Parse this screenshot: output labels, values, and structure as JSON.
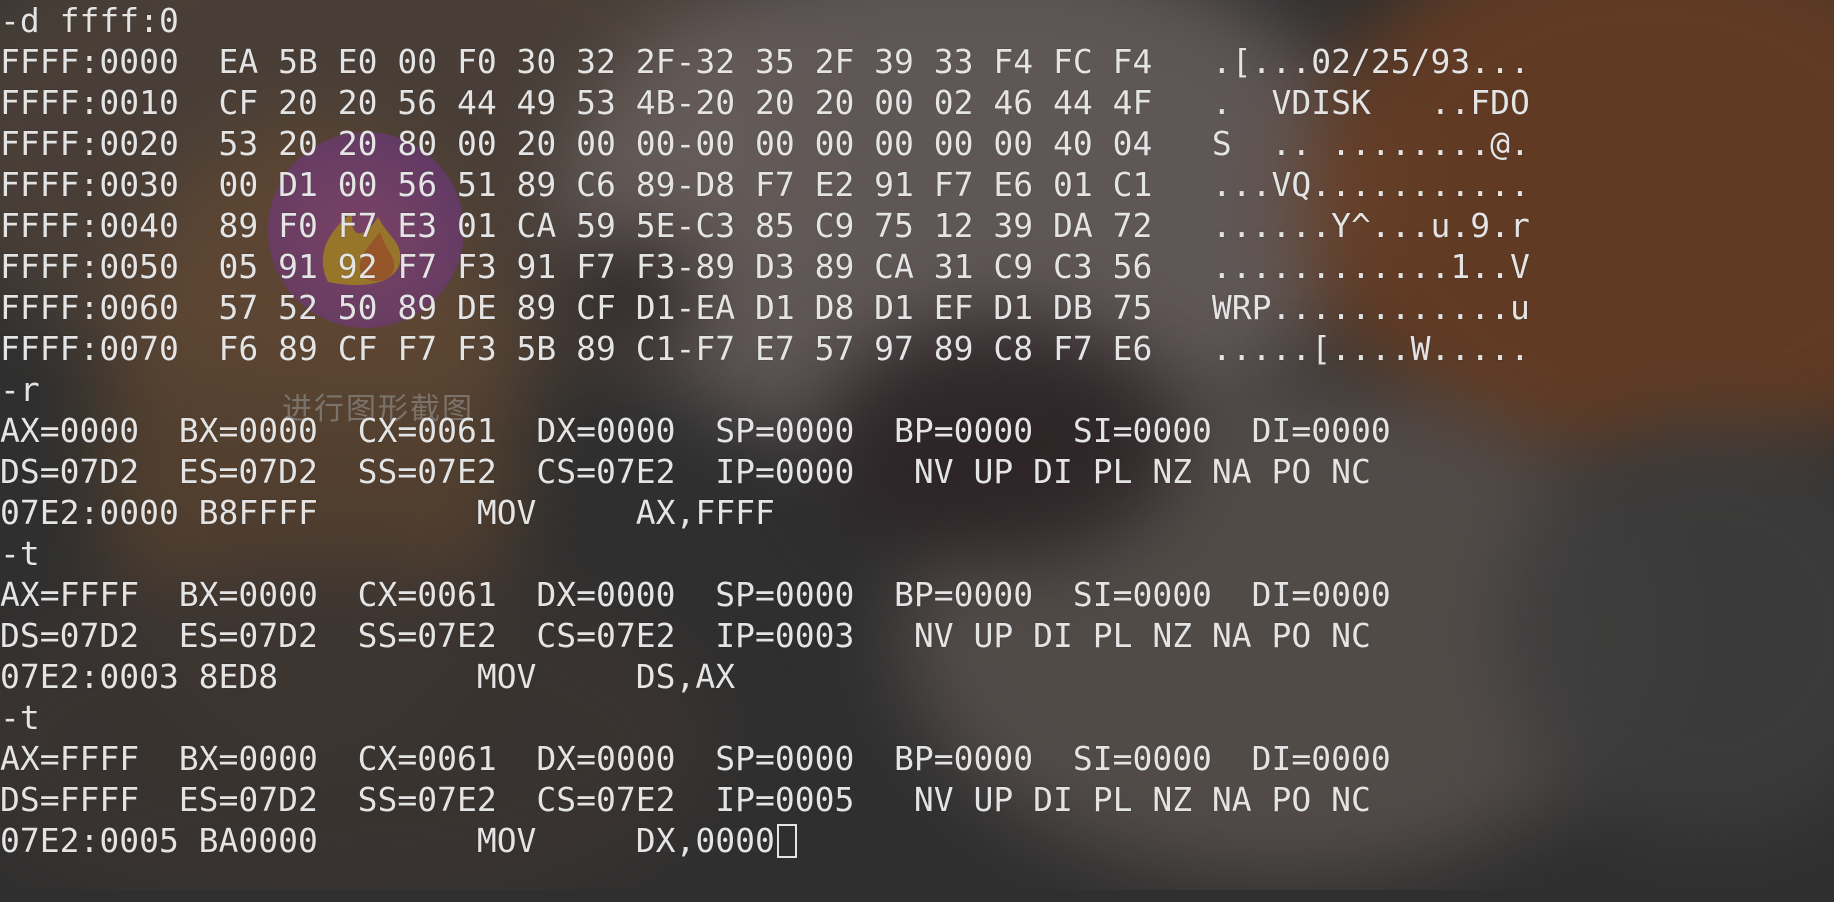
{
  "window": {
    "title": ""
  },
  "watermark": {
    "caption": "进行图形截图",
    "icon": "flame-logo-icon"
  },
  "console": {
    "lines": [
      "-d ffff:0",
      "FFFF:0000  EA 5B E0 00 F0 30 32 2F-32 35 2F 39 33 F4 FC F4   .[...02/25/93...",
      "FFFF:0010  CF 20 20 56 44 49 53 4B-20 20 20 00 02 46 44 4F   .  VDISK   ..FDO",
      "FFFF:0020  53 20 20 80 00 20 00 00-00 00 00 00 00 00 40 04   S  .. ........@.",
      "FFFF:0030  00 D1 00 56 51 89 C6 89-D8 F7 E2 91 F7 E6 01 C1   ...VQ...........",
      "FFFF:0040  89 F0 F7 E3 01 CA 59 5E-C3 85 C9 75 12 39 DA 72   ......Y^...u.9.r",
      "FFFF:0050  05 91 92 F7 F3 91 F7 F3-89 D3 89 CA 31 C9 C3 56   ............1..V",
      "FFFF:0060  57 52 50 89 DE 89 CF D1-EA D1 D8 D1 EF D1 DB 75   WRP............u",
      "FFFF:0070  F6 89 CF F7 F3 5B 89 C1-F7 E7 57 97 89 C8 F7 E6   .....[....W.....",
      "-r",
      "AX=0000  BX=0000  CX=0061  DX=0000  SP=0000  BP=0000  SI=0000  DI=0000",
      "DS=07D2  ES=07D2  SS=07E2  CS=07E2  IP=0000   NV UP DI PL NZ NA PO NC",
      "07E2:0000 B8FFFF        MOV     AX,FFFF",
      "-t",
      "AX=FFFF  BX=0000  CX=0061  DX=0000  SP=0000  BP=0000  SI=0000  DI=0000",
      "DS=07D2  ES=07D2  SS=07E2  CS=07E2  IP=0003   NV UP DI PL NZ NA PO NC",
      "07E2:0003 8ED8          MOV     DS,AX",
      "-t",
      "AX=FFFF  BX=0000  CX=0061  DX=0000  SP=0000  BP=0000  SI=0000  DI=0000",
      "DS=FFFF  ES=07D2  SS=07E2  CS=07E2  IP=0005   NV UP DI PL NZ NA PO NC",
      "07E2:0005 BA0000        MOV     DX,0000",
      "-"
    ]
  }
}
